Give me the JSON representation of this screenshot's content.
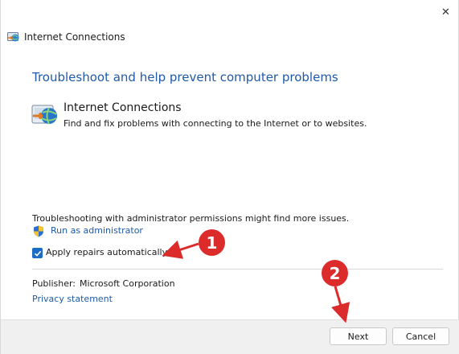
{
  "window": {
    "title": "Internet Connections",
    "close_glyph": "✕"
  },
  "main": {
    "heading": "Troubleshoot and help prevent computer problems",
    "troubleshooter": {
      "title": "Internet Connections",
      "description": "Find and fix problems with connecting to the Internet or to websites."
    },
    "admin_note": "Troubleshooting with administrator permissions might find more issues.",
    "run_as_admin": "Run as administrator",
    "apply_repairs": {
      "label": "Apply repairs automatically",
      "checked": true
    },
    "publisher_label": "Publisher:",
    "publisher_value": "Microsoft Corporation",
    "privacy_link": "Privacy statement"
  },
  "footer": {
    "next_label": "Next",
    "cancel_label": "Cancel"
  },
  "annotations": {
    "callout_1": "1",
    "callout_2": "2",
    "color": "#dc2b2b"
  },
  "colors": {
    "link": "#1f5aa8",
    "checkbox": "#1a6cc6"
  }
}
